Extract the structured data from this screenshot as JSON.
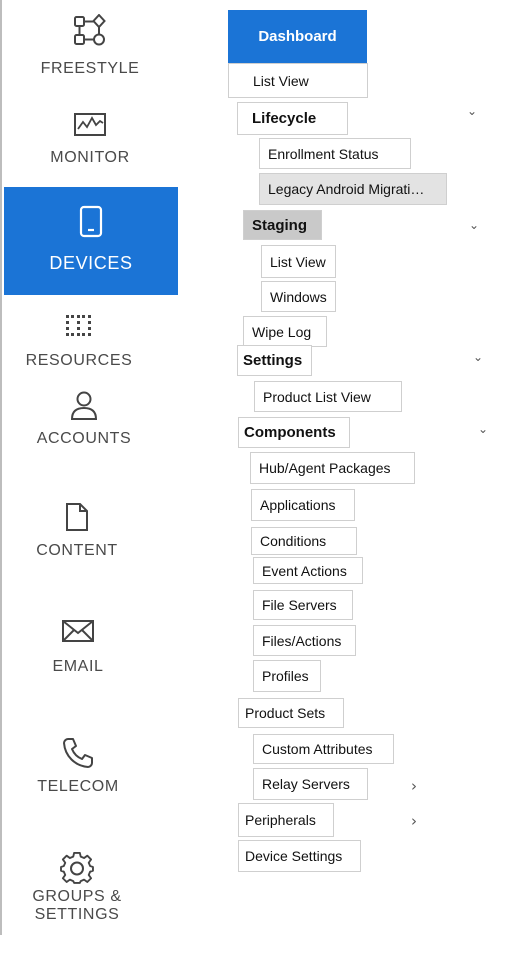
{
  "rail": {
    "freestyle": "FREESTYLE",
    "monitor": "MONITOR",
    "devices": "DEVICES",
    "resources": "RESOURCES",
    "accounts": "ACCOUNTS",
    "content": "CONTENT",
    "email": "EMAIL",
    "telecom": "TELECOM",
    "groups_line1": "GROUPS &",
    "groups_line2": "SETTINGS"
  },
  "tree": {
    "dashboard": "Dashboard",
    "list_view": "List View",
    "lifecycle": "Lifecycle",
    "enrollment_status": "Enrollment Status",
    "legacy_android": "Legacy Android Migrati…",
    "staging": "Staging",
    "staging_list_view": "List View",
    "windows": "Windows",
    "wipe_log": "Wipe Log",
    "settings": "Settings",
    "product_list_view": "Product List View",
    "components": "Components",
    "hub_agent_packages": "Hub/Agent Packages",
    "applications": "Applications",
    "conditions": "Conditions",
    "event_actions": "Event Actions",
    "file_servers": "File Servers",
    "files_actions": "Files/Actions",
    "profiles": "Profiles",
    "product_sets": "Product Sets",
    "custom_attributes": "Custom Attributes",
    "relay_servers": "Relay Servers",
    "peripherals": "Peripherals",
    "device_settings": "Device Settings"
  },
  "icons": {
    "chevron_down": "⌄",
    "chevron_right": "›"
  },
  "colors": {
    "accent": "#1b74d6",
    "selected_bg": "#e3e3e3",
    "staging_bg": "#c9c9c9"
  }
}
